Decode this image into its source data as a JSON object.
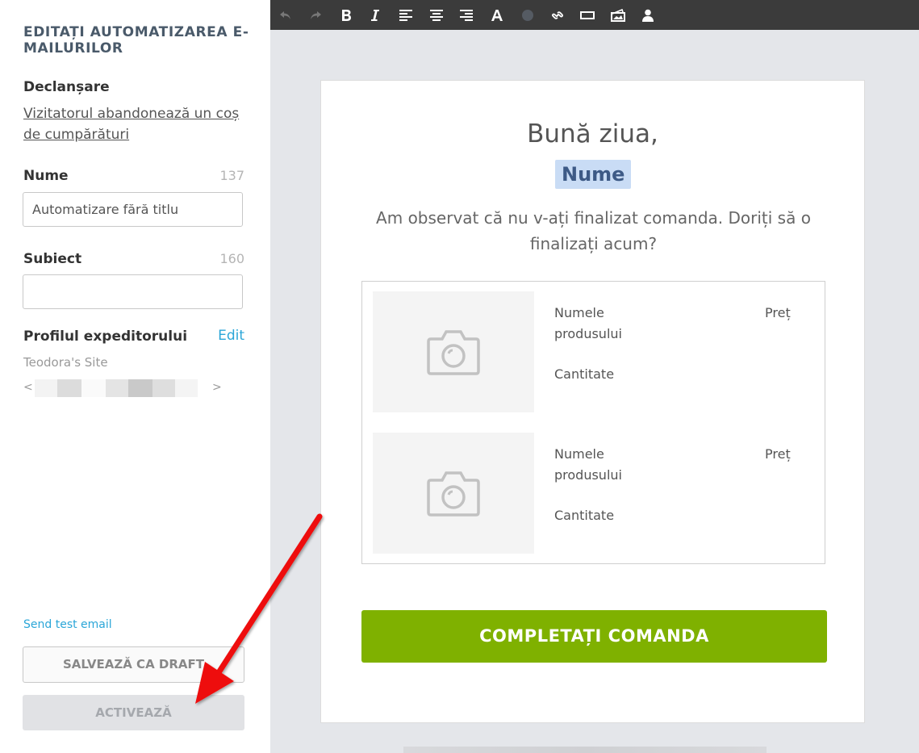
{
  "sidebar": {
    "title": "EDITAȚI AUTOMATIZAREA E-MAILURILOR",
    "trigger_label": "Declanșare",
    "trigger_link": "Vizitatorul abandonează un coș de cumpărături",
    "name_label": "Nume",
    "name_count": "137",
    "name_value": "Automatizare fără titlu",
    "subject_label": "Subiect",
    "subject_count": "160",
    "subject_value": "",
    "sender_label": "Profilul expeditorului",
    "sender_edit": "Edit",
    "sender_name": "Teodora's Site",
    "email_open": "<",
    "email_close": ">",
    "send_test": "Send test email",
    "save_draft": "SALVEAZĂ CA DRAFT",
    "activate": "ACTIVEAZĂ"
  },
  "toolbar": {
    "icons": [
      "undo-icon",
      "redo-icon",
      "bold-icon",
      "italic-icon",
      "align-left-icon",
      "align-center-icon",
      "align-right-icon",
      "font-icon",
      "color-dot-icon",
      "link-icon",
      "button-icon",
      "image-icon",
      "person-icon"
    ]
  },
  "email": {
    "greeting": "Bună ziua,",
    "name_tag": "Nume",
    "message": "Am observat că nu v-ați finalizat comanda. Doriți să o finalizați acum?",
    "products": [
      {
        "name": "Numele produsului",
        "price": "Preț",
        "qty": "Cantitate"
      },
      {
        "name": "Numele produsului",
        "price": "Preț",
        "qty": "Cantitate"
      }
    ],
    "cta": "COMPLETAȚI COMANDA"
  },
  "colors": {
    "accent": "#2ba6d8",
    "cta": "#7fb100",
    "toolbar": "#3b3b3b",
    "canvas": "#e4e6ea",
    "arrow": "#ee1111"
  }
}
